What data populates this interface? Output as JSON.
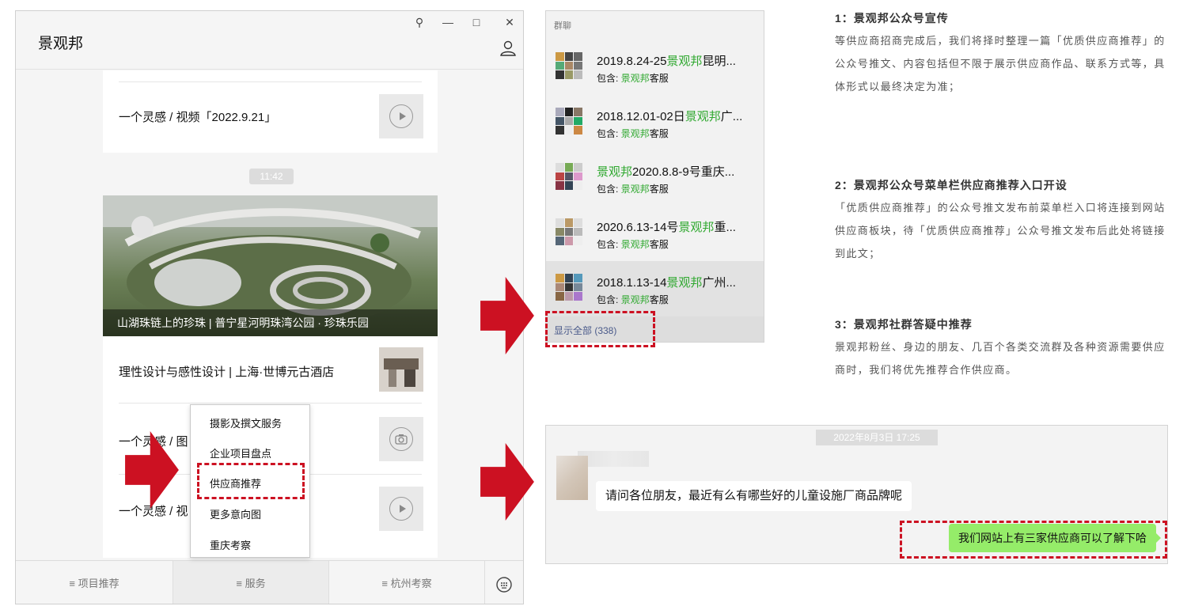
{
  "window": {
    "title": "景观邦",
    "controls": {
      "pin": "⚲",
      "minimize": "—",
      "maximize": "□",
      "close": "✕"
    }
  },
  "chat": {
    "item1_text": "一个灵感 / 视频「2022.9.21」",
    "timestamp": "11:42",
    "photo_caption": "山湖珠链上的珍珠 | 普宁星河明珠湾公园 · 珍珠乐园",
    "item2_text": "理性设计与感性设计 | 上海·世博元古酒店",
    "item3_text": "一个灵感 / 图",
    "item4_text": "一个灵感 / 视"
  },
  "menu": {
    "items": [
      "摄影及撰文服务",
      "企业项目盘点",
      "供应商推荐",
      "更多意向图",
      "重庆考察"
    ]
  },
  "bottom_tabs": [
    "≡ 项目推荐",
    "≡ 服务",
    "≡ 杭州考察"
  ],
  "groups": {
    "header": "群聊",
    "items": [
      {
        "pre": "2019.8.24-25",
        "hl": "景观邦",
        "post": "昆明...",
        "sub_pre": "包含: ",
        "sub_hl": "景观邦",
        "sub_post": "客服"
      },
      {
        "pre": "2018.12.01-02日",
        "hl": "景观邦",
        "post": "广...",
        "sub_pre": "包含: ",
        "sub_hl": "景观邦",
        "sub_post": "客服"
      },
      {
        "pre": "",
        "hl": "景观邦",
        "post": "2020.8.8-9号重庆...",
        "sub_pre": "包含: ",
        "sub_hl": "景观邦",
        "sub_post": "客服"
      },
      {
        "pre": "2020.6.13-14号",
        "hl": "景观邦",
        "post": "重...",
        "sub_pre": "包含: ",
        "sub_hl": "景观邦",
        "sub_post": "客服"
      },
      {
        "pre": "2018.1.13-14",
        "hl": "景观邦",
        "post": "广州...",
        "sub_pre": "包含: ",
        "sub_hl": "景观邦",
        "sub_post": "客服"
      }
    ],
    "show_all": "显示全部 (338)"
  },
  "info": [
    {
      "heading": "1：景观邦公众号宣传",
      "text": "等供应商招商完成后，我们将择时整理一篇「优质供应商推荐」的公众号推文、内容包括但不限于展示供应商作品、联系方式等，具体形式以最终决定为准；"
    },
    {
      "heading": "2：景观邦公众号菜单栏供应商推荐入口开设",
      "text": "「优质供应商推荐」的公众号推文发布前菜单栏入口将连接到网站供应商板块，待「优质供应商推荐」公众号推文发布后此处将链接到此文；"
    },
    {
      "heading": "3：景观邦社群答疑中推荐",
      "text": "景观邦粉丝、身边的朋友、几百个各类交流群及各种资源需要供应商时，我们将优先推荐合作供应商。"
    }
  ],
  "chat2": {
    "time": "2022年8月3日 17:25",
    "message_in": "请问各位朋友，最近有么有哪些好的儿童设施厂商品牌呢",
    "message_out": "我们网站上有三家供应商可以了解下哈"
  },
  "colors": {
    "accent_red": "#cc1122",
    "highlight_green": "#2fa82f",
    "bubble_green": "#95ec69"
  }
}
